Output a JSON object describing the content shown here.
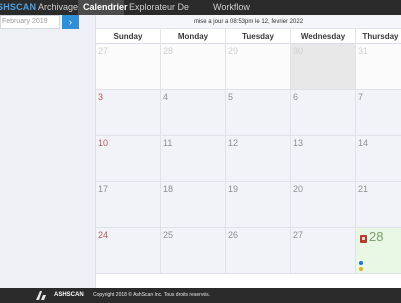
{
  "nav": {
    "brand": "SHSCAN",
    "items": [
      {
        "label": "Archivage"
      },
      {
        "label": "Calendrier"
      },
      {
        "label": "Explorateur De Fichier"
      },
      {
        "label": "Workflow"
      }
    ]
  },
  "sidebar": {
    "month_value": "February 2019",
    "next_button": "›"
  },
  "header": {
    "update_text": "mise a jour a 08:53pm le 12, fevrier 2022"
  },
  "calendar": {
    "days": [
      "Sunday",
      "Monday",
      "Tuesday",
      "Wednesday",
      "Thursday"
    ],
    "weeks": [
      [
        "27",
        "28",
        "29",
        "30",
        "31"
      ],
      [
        "3",
        "4",
        "5",
        "6",
        "7"
      ],
      [
        "10",
        "11",
        "12",
        "13",
        "14"
      ],
      [
        "17",
        "18",
        "19",
        "20",
        "21"
      ],
      [
        "24",
        "25",
        "26",
        "27",
        "28"
      ]
    ],
    "colors": {
      "event_dot_blue": "#1e73d6",
      "event_dot_yellow": "#e0b020",
      "today_bg": "#e9f8e4"
    }
  },
  "footer": {
    "brand": "ASHSCAN",
    "copyright": "Copyright 2018 © AshScan Inc. Tous droits reservés."
  }
}
